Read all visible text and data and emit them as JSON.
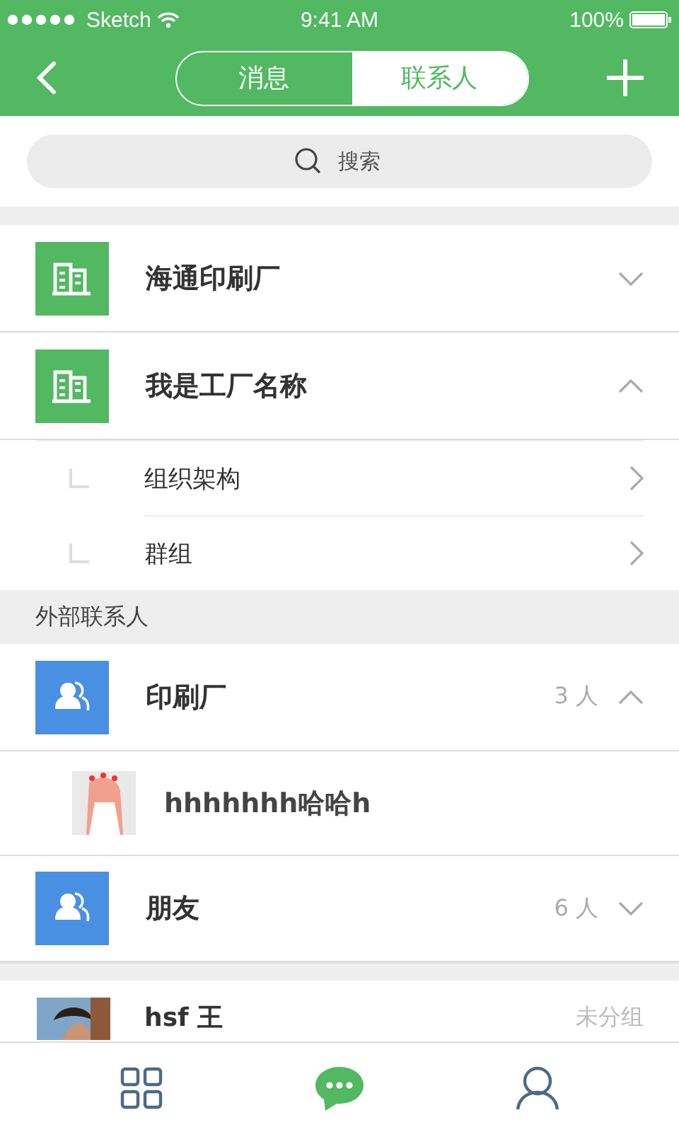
{
  "status_bar": {
    "carrier": "Sketch",
    "time": "9:41 AM",
    "battery": "100%"
  },
  "nav": {
    "tabs": [
      {
        "label": "消息",
        "selected": false
      },
      {
        "label": "联系人",
        "selected": true
      }
    ]
  },
  "search": {
    "placeholder": "搜索"
  },
  "companies": [
    {
      "name": "海通印刷厂",
      "expanded": false
    },
    {
      "name": "我是工厂名称",
      "expanded": true,
      "children": [
        {
          "label": "组织架构"
        },
        {
          "label": "群组"
        }
      ]
    }
  ],
  "external": {
    "title": "外部联系人",
    "groups": [
      {
        "name": "印刷厂",
        "count": "3 人",
        "expanded": true,
        "members": [
          {
            "name": "hhhhhhh哈哈h"
          }
        ]
      },
      {
        "name": "朋友",
        "count": "6 人",
        "expanded": false
      }
    ]
  },
  "contacts": [
    {
      "name": "hsf 王",
      "group": "未分组"
    }
  ],
  "tab_bar": [
    {
      "kind": "apps",
      "selected": false
    },
    {
      "kind": "chat",
      "selected": true
    },
    {
      "kind": "profile",
      "selected": false
    }
  ]
}
